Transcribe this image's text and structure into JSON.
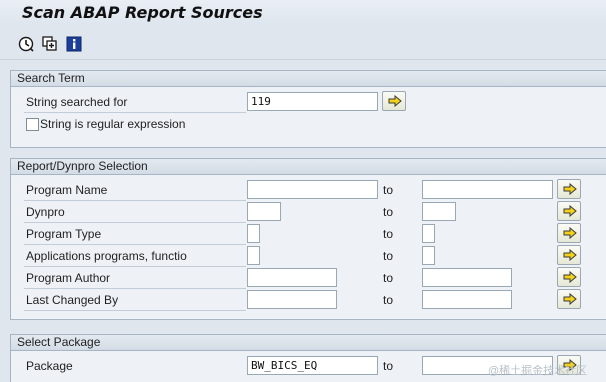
{
  "window": {
    "title": "Scan ABAP Report Sources"
  },
  "toolbar": {
    "icons": [
      "execute-icon",
      "copy-variant-icon",
      "info-icon"
    ]
  },
  "search_term": {
    "header": "Search Term",
    "string_label": "String searched for",
    "string_value": "119",
    "regex_label": "String is regular expression",
    "regex_checked": false
  },
  "report_selection": {
    "header": "Report/Dynpro Selection",
    "to_label": "to",
    "rows": [
      {
        "label": "Program Name",
        "from": "",
        "to": ""
      },
      {
        "label": "Dynpro",
        "from": "",
        "to": ""
      },
      {
        "label": "Program Type",
        "from": "",
        "to": ""
      },
      {
        "label": "Applications programs, functio",
        "from": "",
        "to": ""
      },
      {
        "label": "Program Author",
        "from": "",
        "to": ""
      },
      {
        "label": "Last Changed By",
        "from": "",
        "to": ""
      }
    ]
  },
  "package_selection": {
    "header": "Select Package",
    "package_label": "Package",
    "package_from": "BW_BICS_EQ",
    "to_label": "to",
    "package_to": ""
  },
  "watermark": "@稀土掘金技术社区",
  "colors": {
    "background": "#dfe6ee",
    "group_background": "#eef2f6",
    "button_arrow": "#f3d21c"
  }
}
